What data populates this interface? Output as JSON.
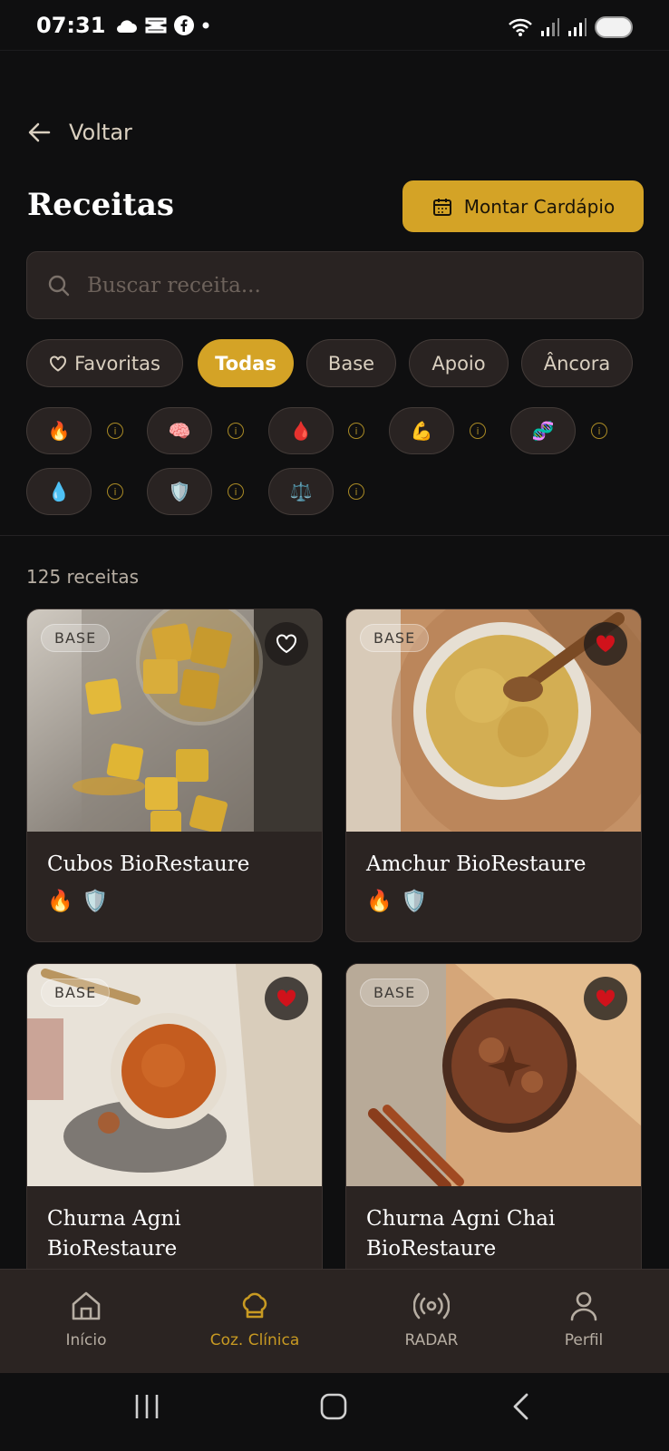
{
  "status_bar": {
    "time": "07:31"
  },
  "header": {
    "back_label": "Voltar",
    "title": "Receitas",
    "menu_button_label": "Montar Cardápio"
  },
  "search": {
    "placeholder": "Buscar receita..."
  },
  "filters": {
    "chips": [
      {
        "label": "Favoritas",
        "icon": "heart-outline-icon",
        "active": false
      },
      {
        "label": "Todas",
        "active": true
      },
      {
        "label": "Base",
        "active": false
      },
      {
        "label": "Apoio",
        "active": false
      },
      {
        "label": "Âncora",
        "active": false
      }
    ],
    "property_tags": [
      {
        "emoji": "🔥",
        "icon": "fire-icon"
      },
      {
        "emoji": "🧠",
        "icon": "brain-icon"
      },
      {
        "emoji": "🩸",
        "icon": "blood-drop-icon"
      },
      {
        "emoji": "💪",
        "icon": "flexed-biceps-icon"
      },
      {
        "emoji": "🧬",
        "icon": "dna-icon"
      },
      {
        "emoji": "💧",
        "icon": "water-drop-icon"
      },
      {
        "emoji": "🛡️",
        "icon": "shield-icon"
      },
      {
        "emoji": "⚖️",
        "icon": "balance-scale-icon"
      }
    ],
    "info_symbol": "i"
  },
  "results": {
    "count_text": "125 receitas"
  },
  "recipes": [
    {
      "name": "Cubos BioRestaure",
      "badge": "BASE",
      "favorite": false,
      "tags": [
        "🔥",
        "🛡️"
      ]
    },
    {
      "name": "Amchur BioRestaure",
      "badge": "BASE",
      "favorite": true,
      "tags": [
        "🔥",
        "🛡️"
      ]
    },
    {
      "name": "Churna Agni BioRestaure",
      "badge": "BASE",
      "favorite": true,
      "tags": []
    },
    {
      "name": "Churna Agni Chai BioRestaure",
      "badge": "BASE",
      "favorite": true,
      "tags": []
    }
  ],
  "bottom_nav": [
    {
      "label": "Início",
      "icon": "home-icon",
      "active": false
    },
    {
      "label": "Coz. Clínica",
      "icon": "chef-hat-icon",
      "active": true
    },
    {
      "label": "RADAR",
      "icon": "radar-broadcast-icon",
      "active": false
    },
    {
      "label": "Perfil",
      "icon": "user-icon",
      "active": false
    }
  ],
  "colors": {
    "background": "#0f0f10",
    "accent": "#d4a326",
    "card": "#2b2422",
    "favorite_red": "#d0121b"
  }
}
